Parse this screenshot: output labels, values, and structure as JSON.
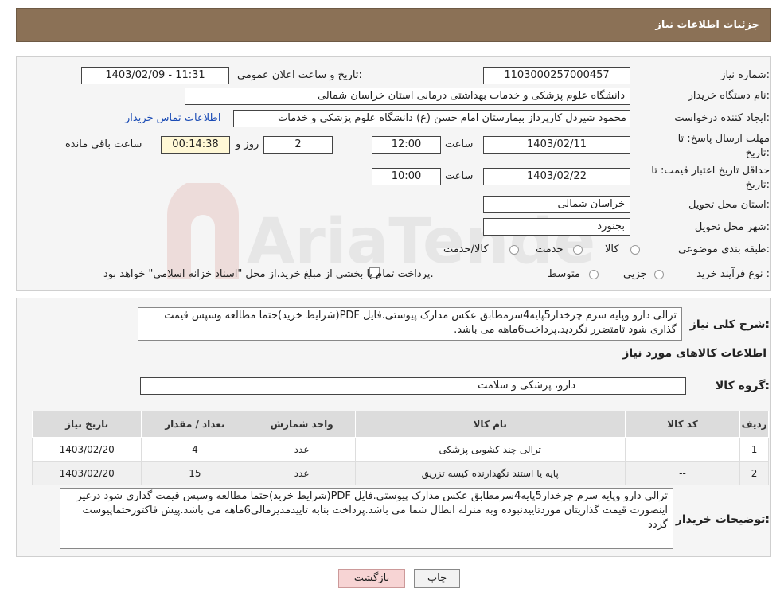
{
  "header": {
    "title": "جزئیات اطلاعات نیاز"
  },
  "form": {
    "need_number_label": "شماره نیاز:",
    "need_number": "1103000257000457",
    "announce_label": "تاریخ و ساعت اعلان عمومی:",
    "announce_value": "1403/02/09 - 11:31",
    "buyer_org_label": "نام دستگاه خریدار:",
    "buyer_org": "دانشگاه علوم پزشکی و خدمات بهداشتی درمانی استان خراسان شمالی",
    "requester_label": "ایجاد کننده درخواست:",
    "requester": "محمود شیردل کارپرداز بیمارستان امام حسن (ع) دانشگاه علوم پزشکی و خدمات",
    "contact_link": "اطلاعات تماس خریدار",
    "deadline_label_1": "مهلت ارسال پاسخ: تا",
    "deadline_label_2": "تاریخ:",
    "deadline_date": "1403/02/11",
    "time_label": "ساعت",
    "deadline_time": "12:00",
    "days_value": "2",
    "days_label": "روز و",
    "remaining_time": "00:14:38",
    "remaining_label": "ساعت باقی مانده",
    "validity_label_1": "حداقل تاریخ اعتبار قیمت: تا",
    "validity_label_2": "تاریخ:",
    "validity_date": "1403/02/22",
    "validity_time_label": "ساعت",
    "validity_time": "10:00",
    "province_label": "استان محل تحویل:",
    "province": "خراسان شمالی",
    "city_label": "شهر محل تحویل:",
    "city": "بجنورد",
    "category_label": "طبقه بندی موضوعی:",
    "category_options": [
      "کالا",
      "خدمت",
      "کالا/خدمت"
    ],
    "process_label": "نوع فرآیند خرید :",
    "process_options": [
      "جزیی",
      "متوسط"
    ],
    "process_note": "پرداخت تمام یا بخشی از مبلغ خرید،از محل \"اسناد خزانه اسلامی\" خواهد بود."
  },
  "details": {
    "summary_label": "شرح کلی نیاز:",
    "summary_text": "ترالی دارو وپایه سرم چرخدار5پایه4سرمطابق عکس مدارک پیوستی.فایل PDF(شرایط خرید)حتما مطالعه وسپس قیمت گذاری شود تامتضرر نگردید.پرداخت6ماهه می باشد.",
    "goods_info_title": "اطلاعات کالاهای مورد نیاز",
    "group_label": "گروه کالا:",
    "group_value": "دارو، پزشکی و سلامت",
    "table": {
      "headers": [
        "ردیف",
        "کد کالا",
        "نام کالا",
        "واحد شمارش",
        "تعداد / مقدار",
        "تاریخ نیاز"
      ],
      "rows": [
        [
          "1",
          "--",
          "ترالی چند کشویی پزشکی",
          "عدد",
          "4",
          "1403/02/20"
        ],
        [
          "2",
          "--",
          "پایه یا استند نگهدارنده کیسه تزریق",
          "عدد",
          "15",
          "1403/02/20"
        ]
      ]
    },
    "buyer_notes_label": "توضیحات خریدار:",
    "buyer_notes": "ترالی دارو وپایه سرم چرخدار5پایه4سرمطابق عکس مدارک پیوستی.فایل PDF(شرایط خرید)حتما مطالعه وسپس قیمت گذاری شود درغیر اینصورت قیمت گذاریتان موردتاییدنبوده وبه منزله ابطال شما می باشد.پرداخت بنابه تاییدمدیرمالی6ماهه می باشد.پیش فاکتورحتماپیوست گردد"
  },
  "buttons": {
    "print": "چاپ",
    "back": "بازگشت"
  },
  "watermark": {
    "text": "AriaTender.neT"
  },
  "colors": {
    "header_bg": "#8b7156",
    "link": "#1a4bb5",
    "back_btn_bg": "#f7d4d4"
  }
}
